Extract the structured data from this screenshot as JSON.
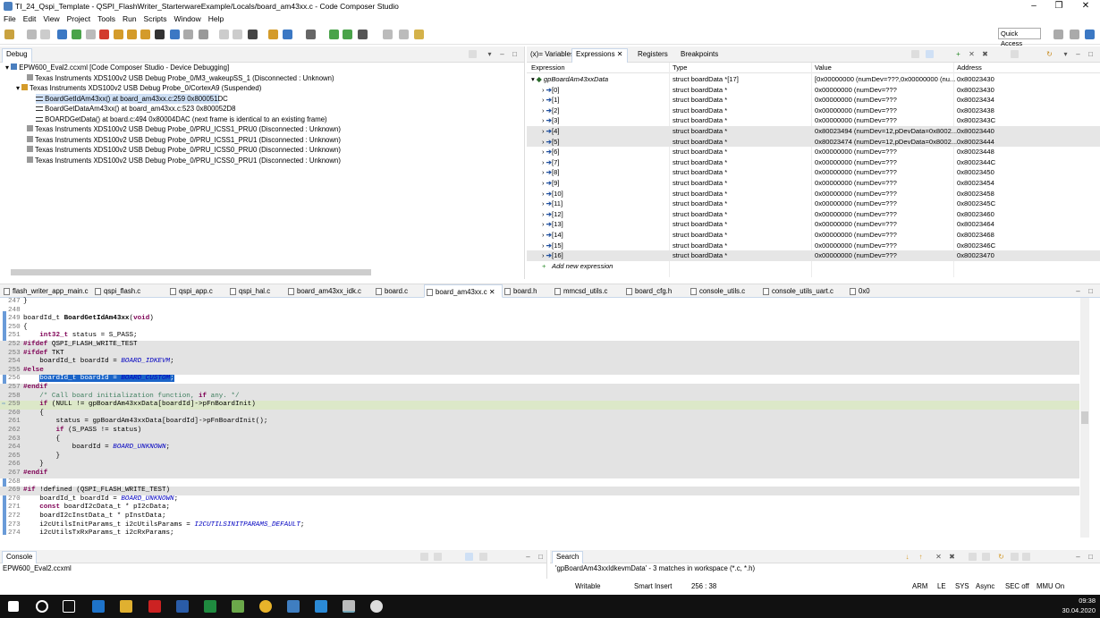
{
  "window": {
    "title": "TI_24_Qspi_Template - QSPI_FlashWriter_StarterwareExample/Locals/board_am43xx.c - Code Composer Studio",
    "minimize": "–",
    "maximize": "❐",
    "close": "✕"
  },
  "menu": [
    "File",
    "Edit",
    "View",
    "Project",
    "Tools",
    "Run",
    "Scripts",
    "Window",
    "Help"
  ],
  "quick_access": "Quick Access",
  "debug": {
    "tab_label": "Debug",
    "rows": [
      "EPW600_Eval2.ccxml [Code Composer Studio - Device Debugging]",
      "Texas Instruments XDS100v2 USB Debug Probe_0/M3_wakeupSS_1 (Disconnected : Unknown)",
      "Texas Instruments XDS100v2 USB Debug Probe_0/CortexA9 (Suspended)",
      "BoardGetIdAm43xx() at board_am43xx.c:259 0x800051DC",
      "BoardGetDataAm43xx() at board_am43xx.c:523 0x800052D8",
      "BOARDGetData() at board.c:494 0x80004DAC  (next frame is identical to an existing frame)",
      "Texas Instruments XDS100v2 USB Debug Probe_0/PRU_ICSS1_PRU0 (Disconnected : Unknown)",
      "Texas Instruments XDS100v2 USB Debug Probe_0/PRU_ICSS1_PRU1 (Disconnected : Unknown)",
      "Texas Instruments XDS100v2 USB Debug Probe_0/PRU_ICSS0_PRU0 (Disconnected : Unknown)",
      "Texas Instruments XDS100v2 USB Debug Probe_0/PRU_ICSS0_PRU1 (Disconnected : Unknown)"
    ]
  },
  "exprpane": {
    "tabs": [
      "(x)= Variables",
      "Expressions",
      "Registers",
      "Breakpoints"
    ],
    "headers": [
      "Expression",
      "Type",
      "Value",
      "Address"
    ],
    "root": {
      "name": "gpBoardAm43xxData",
      "type": "struct boardData *[17]",
      "value": "[0x00000000 (numDev=???,0x00000000 (nu...",
      "address": "0x80023430"
    },
    "rows": [
      {
        "name": "[0]",
        "type": "struct boardData *",
        "value": "0x00000000 (numDev=???",
        "address": "0x80023430"
      },
      {
        "name": "[1]",
        "type": "struct boardData *",
        "value": "0x00000000 (numDev=???",
        "address": "0x80023434"
      },
      {
        "name": "[2]",
        "type": "struct boardData *",
        "value": "0x00000000 (numDev=???",
        "address": "0x80023438"
      },
      {
        "name": "[3]",
        "type": "struct boardData *",
        "value": "0x00000000 (numDev=???",
        "address": "0x8002343C"
      },
      {
        "name": "[4]",
        "type": "struct boardData *",
        "value": "0x80023494 (numDev=12,pDevData=0x8002...",
        "address": "0x80023440"
      },
      {
        "name": "[5]",
        "type": "struct boardData *",
        "value": "0x80023474 (numDev=12,pDevData=0x8002...",
        "address": "0x80023444"
      },
      {
        "name": "[6]",
        "type": "struct boardData *",
        "value": "0x00000000 (numDev=???",
        "address": "0x80023448"
      },
      {
        "name": "[7]",
        "type": "struct boardData *",
        "value": "0x00000000 (numDev=???",
        "address": "0x8002344C"
      },
      {
        "name": "[8]",
        "type": "struct boardData *",
        "value": "0x00000000 (numDev=???",
        "address": "0x80023450"
      },
      {
        "name": "[9]",
        "type": "struct boardData *",
        "value": "0x00000000 (numDev=???",
        "address": "0x80023454"
      },
      {
        "name": "[10]",
        "type": "struct boardData *",
        "value": "0x00000000 (numDev=???",
        "address": "0x80023458"
      },
      {
        "name": "[11]",
        "type": "struct boardData *",
        "value": "0x00000000 (numDev=???",
        "address": "0x8002345C"
      },
      {
        "name": "[12]",
        "type": "struct boardData *",
        "value": "0x00000000 (numDev=???",
        "address": "0x80023460"
      },
      {
        "name": "[13]",
        "type": "struct boardData *",
        "value": "0x00000000 (numDev=???",
        "address": "0x80023464"
      },
      {
        "name": "[14]",
        "type": "struct boardData *",
        "value": "0x00000000 (numDev=???",
        "address": "0x80023468"
      },
      {
        "name": "[15]",
        "type": "struct boardData *",
        "value": "0x00000000 (numDev=???",
        "address": "0x8002346C"
      },
      {
        "name": "[16]",
        "type": "struct boardData *",
        "value": "0x00000000 (numDev=???",
        "address": "0x80023470"
      }
    ],
    "add_new": "Add new expression"
  },
  "editor": {
    "tabs": [
      "flash_writer_app_main.c",
      "qspi_flash.c",
      "qspi_app.c",
      "qspi_hal.c",
      "board_am43xx_idk.c",
      "board.c",
      "board_am43xx.c",
      "board.h",
      "mmcsd_utils.c",
      "board_cfg.h",
      "console_utils.c",
      "console_utils_uart.c",
      "0x0"
    ],
    "lines": [
      {
        "n": "247",
        "t": "}"
      },
      {
        "n": "248",
        "t": ""
      },
      {
        "n": "249",
        "t": "boardId_t BoardGetIdAm43xx(void)"
      },
      {
        "n": "250",
        "t": "{"
      },
      {
        "n": "251",
        "t": "    int32_t status = S_PASS;"
      },
      {
        "n": "252",
        "t": "#ifdef QSPI_FLASH_WRITE_TEST"
      },
      {
        "n": "253",
        "t": "#ifdef TKT"
      },
      {
        "n": "254",
        "t": "    boardId_t boardId = BOARD_IDKEVM;"
      },
      {
        "n": "255",
        "t": "#else"
      },
      {
        "n": "256",
        "t": "    boardId_t boardId = BOARD_CUSTOM;"
      },
      {
        "n": "257",
        "t": "#endif"
      },
      {
        "n": "258",
        "t": "    /* Call board initialization function, if any. */"
      },
      {
        "n": "259",
        "t": "    if (NULL != gpBoardAm43xxData[boardId]->pFnBoardInit)"
      },
      {
        "n": "260",
        "t": "    {"
      },
      {
        "n": "261",
        "t": "        status = gpBoardAm43xxData[boardId]->pFnBoardInit();"
      },
      {
        "n": "262",
        "t": "        if (S_PASS != status)"
      },
      {
        "n": "263",
        "t": "        {"
      },
      {
        "n": "264",
        "t": "            boardId = BOARD_UNKNOWN;"
      },
      {
        "n": "265",
        "t": "        }"
      },
      {
        "n": "266",
        "t": "    }"
      },
      {
        "n": "267",
        "t": "#endif"
      },
      {
        "n": "268",
        "t": ""
      },
      {
        "n": "269",
        "t": "#if !defined (QSPI_FLASH_WRITE_TEST)"
      },
      {
        "n": "270",
        "t": "    boardId_t boardId = BOARD_UNKNOWN;"
      },
      {
        "n": "271",
        "t": "    const boardI2cData_t * pI2cData;"
      },
      {
        "n": "272",
        "t": "    boardI2cInstData_t * pInstData;"
      },
      {
        "n": "273",
        "t": "    i2cUtilsInitParams_t i2cUtilsParams = I2CUTILSINITPARAMS_DEFAULT;"
      },
      {
        "n": "274",
        "t": "    i2cUtilsTxRxParams_t i2cRxParams;"
      }
    ]
  },
  "console": {
    "tab": "Console",
    "line": "EPW600_Eval2.ccxml"
  },
  "search": {
    "tab": "Search",
    "line": "'gpBoardAm43xxIdkevmData' - 3 matches in workspace (*.c, *.h)"
  },
  "status": {
    "writable": "Writable",
    "insert": "Smart Insert",
    "pos": "256 : 38",
    "arm": "ARM",
    "le": "LE",
    "sys": "SYS",
    "async": "Async",
    "sec": "SEC off",
    "mmu": "MMU On"
  },
  "clock": {
    "time": "09:38",
    "date": "30.04.2020"
  }
}
